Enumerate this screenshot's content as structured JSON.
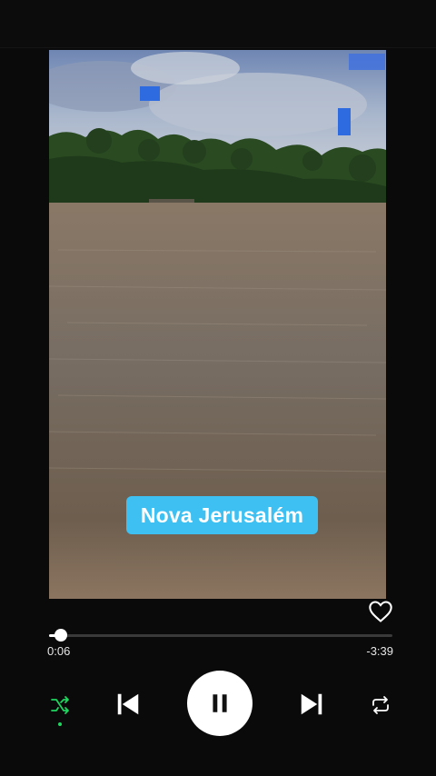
{
  "player": {
    "caption": "Nova Jerusalém",
    "progress_fraction": 0.035,
    "elapsed": "0:06",
    "remaining": "-3:39",
    "shuffle_active": true,
    "accent_color": "#1ed760",
    "caption_bg_color": "#3ec1f2"
  },
  "controls": {
    "like_icon": "heart-outline-icon",
    "shuffle_icon": "shuffle-icon",
    "prev_icon": "skip-previous-icon",
    "play_icon": "pause-icon",
    "next_icon": "skip-next-icon",
    "repeat_icon": "repeat-icon"
  }
}
